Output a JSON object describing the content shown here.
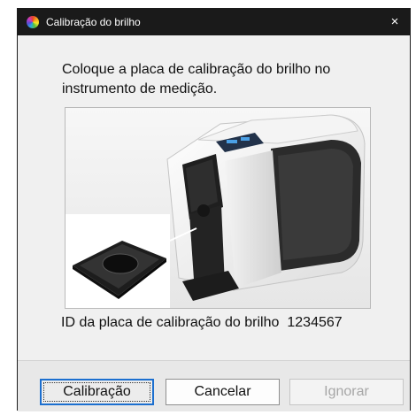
{
  "dialog": {
    "title": "Calibração do brilho",
    "close_glyph": "×",
    "app_icon": "color-wheel-icon"
  },
  "content": {
    "instruction": "Coloque a placa de calibração do brilho no instrumento de medição.",
    "illustration": "instrument-with-calibration-plate-image",
    "plate_id_label": "ID da placa de calibração do brilho",
    "plate_id_value": "1234567"
  },
  "buttons": {
    "calibrate": "Calibração",
    "cancel": "Cancelar",
    "ignore": "Ignorar"
  },
  "colors": {
    "titlebar": "#1a1a1a",
    "dialog_bg": "#f0f0f0",
    "focus_border": "#1c6fcf"
  }
}
